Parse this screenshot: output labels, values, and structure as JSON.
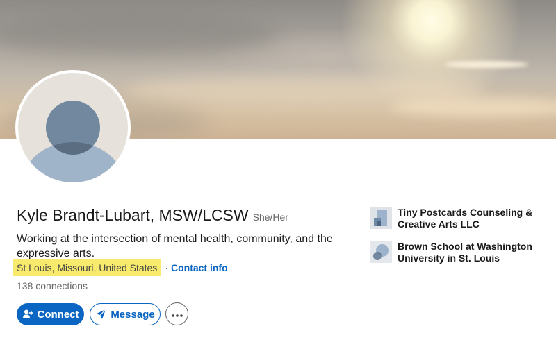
{
  "profile": {
    "name": "Kyle Brandt-Lubart, MSW/LCSW",
    "pronouns": "She/Her",
    "headline": "Working at the intersection of mental health, community, and the expressive arts.",
    "location": "St Louis, Missouri, United States",
    "separator": "·",
    "contact_label": "Contact info",
    "connections": "138 connections"
  },
  "actions": {
    "connect_label": "Connect",
    "message_label": "Message",
    "more_icon": "more-horizontal-icon"
  },
  "sidebar": {
    "items": [
      {
        "label": "Tiny Postcards Counseling & Creative Arts LLC",
        "icon": "company-logo"
      },
      {
        "label": "Brown School at Washington University in St. Louis",
        "icon": "school-logo"
      }
    ]
  },
  "colors": {
    "primary": "#0a66c2",
    "highlight": "#f7ea6c",
    "text": "#191919",
    "muted": "#666666"
  }
}
